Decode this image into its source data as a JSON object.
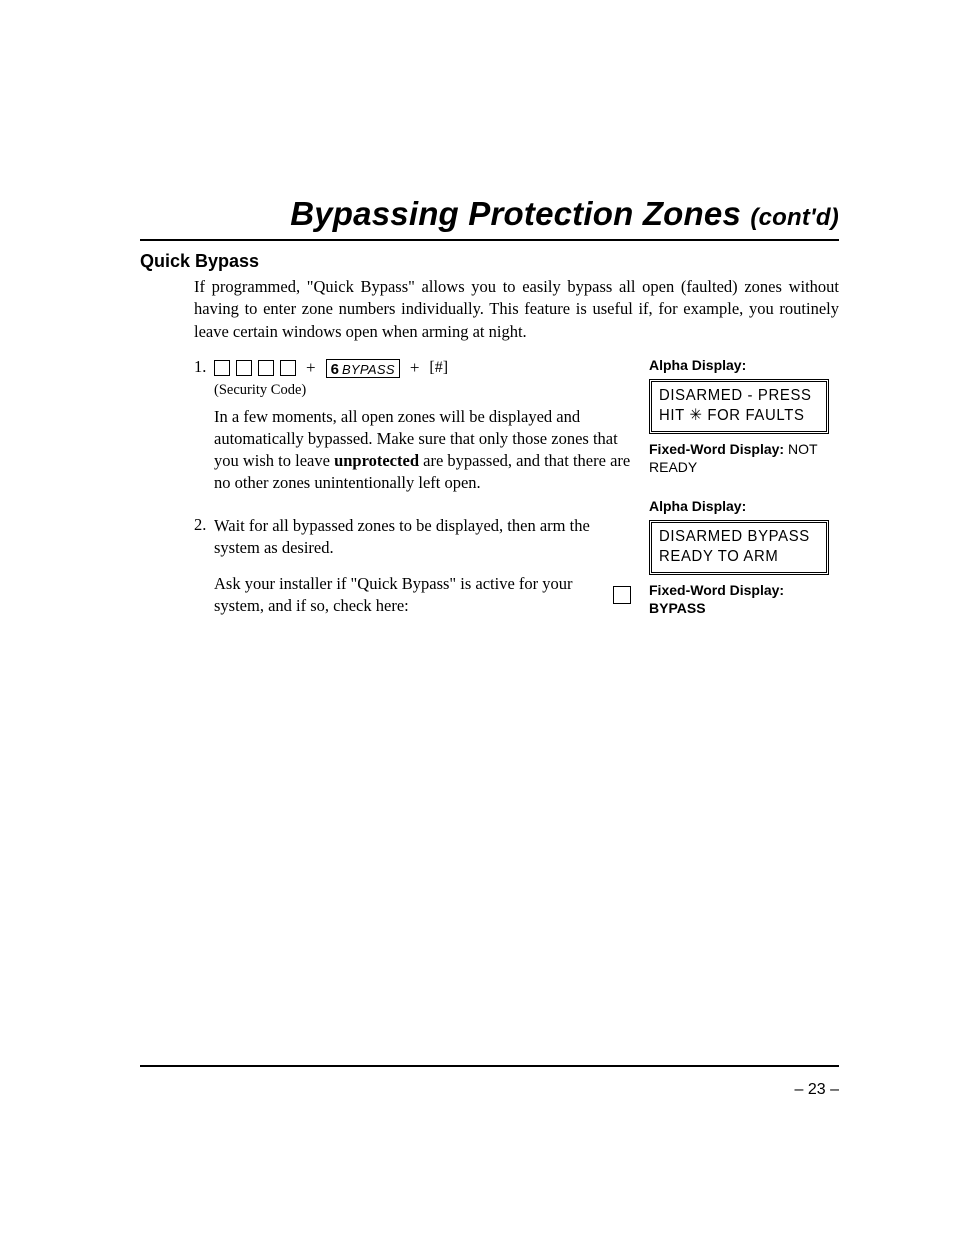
{
  "title": "Bypassing Protection Zones",
  "title_contd": "(cont'd)",
  "section_heading": "Quick Bypass",
  "intro": "If programmed, \"Quick Bypass\" allows you to easily bypass all open (faulted) zones without having to enter zone numbers individually. This feature is useful if, for example, you routinely leave certain windows open when arming at night.",
  "step1": {
    "num": "1.",
    "key_number": "6",
    "key_label": "BYPASS",
    "pound": "[#]",
    "plus": "+",
    "security_code_note": "(Security Code)",
    "body_a": "In a few moments, all open zones will be displayed and automatically bypassed. Make sure that only those zones that you wish to leave ",
    "body_bold": "unprotected",
    "body_b": " are bypassed, and that there are no other zones unintentionally left open."
  },
  "step2": {
    "num": "2.",
    "body_a": "Wait for all bypassed zones to be displayed, then arm the system as desired.",
    "body_b": "Ask your installer if \"Quick Bypass\" is active for your system, and if so, check here:"
  },
  "display1": {
    "alpha_label": "Alpha Display:",
    "lcd_line1": "DISARMED - PRESS",
    "lcd_line2": "HIT ✳ FOR FAULTS",
    "fwd_label": "Fixed-Word Display:",
    "fwd_value": "NOT READY"
  },
  "display2": {
    "alpha_label": "Alpha Display:",
    "lcd_line1": "DISARMED BYPASS",
    "lcd_line2": "READY TO ARM",
    "fwd_label": "Fixed-Word Display:",
    "fwd_value": "BYPASS"
  },
  "page_number": "– 23 –"
}
